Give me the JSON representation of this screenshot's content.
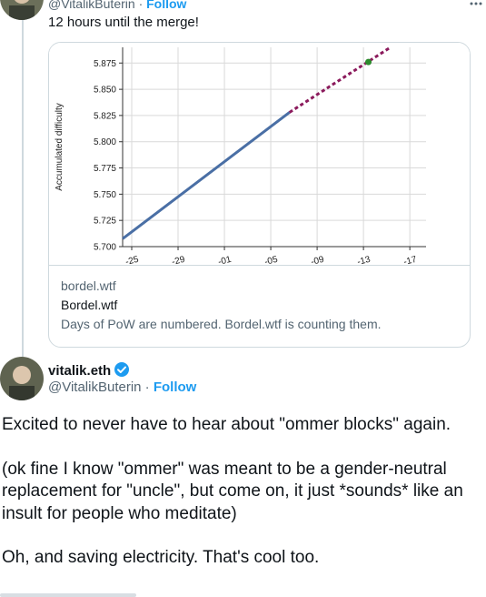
{
  "top_tweet": {
    "handle": "@VitalikButerin",
    "separator": "·",
    "follow_label": "Follow",
    "text": "12 hours until the merge!",
    "card": {
      "domain": "bordel.wtf",
      "title": "Bordel.wtf",
      "description": "Days of PoW are numbered. Bordel.wtf is counting them."
    }
  },
  "main_tweet": {
    "name": "vitalik.eth",
    "handle": "@VitalikButerin",
    "separator": "·",
    "follow_label": "Follow",
    "paragraphs": [
      "Excited to never have to hear about \"ommer blocks\" again.",
      "(ok fine I know \"ommer\" was meant to be a gender-neutral replacement for \"uncle\", but come on, it just *sounds* like an insult for people who meditate)",
      "Oh, and saving electricity. That's cool too."
    ]
  },
  "chart_data": {
    "type": "line",
    "ylabel": "Accumulated difficulty",
    "ylim": [
      5.7,
      5.89
    ],
    "yticks": [
      "5.700",
      "5.725",
      "5.750",
      "5.775",
      "5.800",
      "5.825",
      "5.850",
      "5.875"
    ],
    "xtick_labels": [
      "-25",
      "-29",
      "-01",
      "-05",
      "-09",
      "-13",
      "-17"
    ],
    "grid": true,
    "series": [
      {
        "style": "solid",
        "color": "#4a6fa5",
        "x": [
          0.0,
          0.55
        ],
        "y": [
          5.7075,
          5.828
        ]
      },
      {
        "style": "dashed",
        "color": "#8b1a5c",
        "x": [
          0.55,
          0.88
        ],
        "y": [
          5.828,
          5.8895
        ]
      }
    ],
    "marker": {
      "x": 0.81,
      "y": 5.876,
      "color": "#2e8b2e"
    }
  },
  "colors": {
    "link": "#1d9bf0",
    "secondary_text": "#536471",
    "border": "#cfd9de"
  }
}
